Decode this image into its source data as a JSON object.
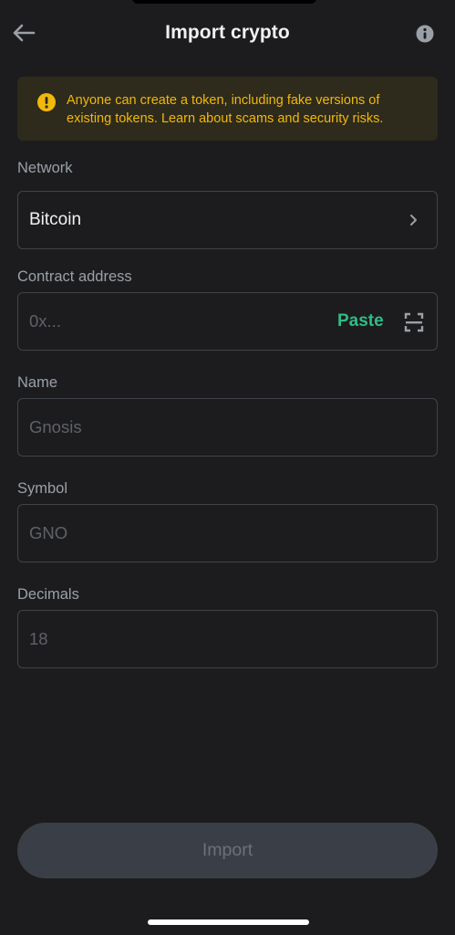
{
  "header": {
    "title": "Import crypto",
    "back_icon": "arrow-left-icon",
    "info_icon": "info-icon"
  },
  "warning": {
    "icon": "exclamation-circle-icon",
    "text": "Anyone can create a token, including fake versions of existing tokens. Learn about scams and security risks.",
    "color": "#f0b90b"
  },
  "network": {
    "label": "Network",
    "value": "Bitcoin"
  },
  "contract": {
    "label": "Contract address",
    "placeholder": "0x...",
    "paste_label": "Paste",
    "paste_color": "#2ebd85"
  },
  "name": {
    "label": "Name",
    "placeholder": "Gnosis"
  },
  "symbol": {
    "label": "Symbol",
    "placeholder": "GNO"
  },
  "decimals": {
    "label": "Decimals",
    "placeholder": "18"
  },
  "import_button": {
    "label": "Import",
    "disabled": true
  }
}
